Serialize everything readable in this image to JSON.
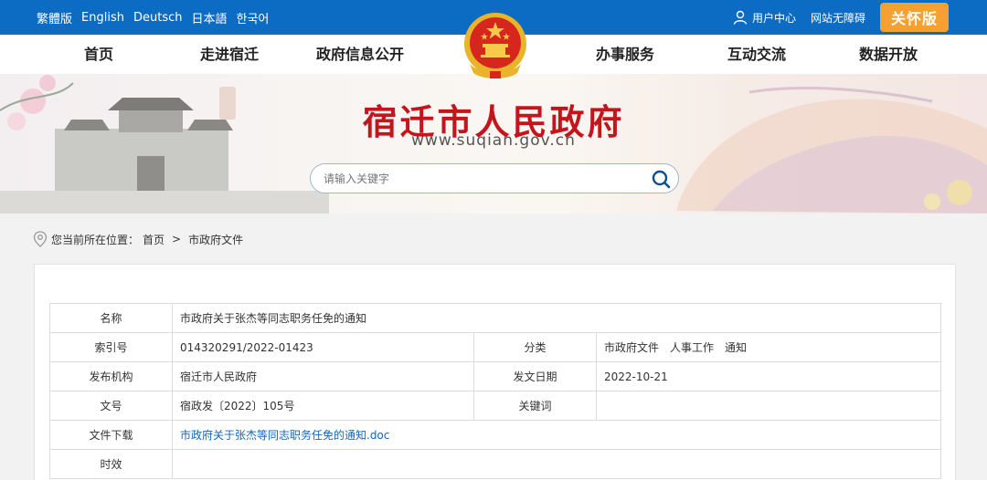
{
  "topbar": {
    "languages": [
      "繁體版",
      "English",
      "Deutsch",
      "日本語",
      "한국어"
    ],
    "user_center": "用户中心",
    "accessibility": "网站无障碍",
    "care_mode": "关怀版"
  },
  "nav": {
    "items": [
      "首页",
      "走进宿迁",
      "政府信息公开",
      "办事服务",
      "互动交流",
      "数据开放"
    ]
  },
  "banner": {
    "title": "宿迁市人民政府",
    "url": "www.suqian.gov.cn",
    "search_placeholder": "请输入关键字"
  },
  "breadcrumb": {
    "prefix": "您当前所在位置：",
    "home": "首页",
    "separator": ">",
    "current": "市政府文件"
  },
  "doc": {
    "name_label": "名称",
    "name_value": "市政府关于张杰等同志职务任免的通知",
    "index_label": "索引号",
    "index_value": "014320291/2022-01423",
    "category_label": "分类",
    "category_value": "市政府文件　人事工作　通知",
    "publisher_label": "发布机构",
    "publisher_value": "宿迁市人民政府",
    "date_label": "发文日期",
    "date_value": "2022-10-21",
    "docno_label": "文号",
    "docno_value": "宿政发〔2022〕105号",
    "keywords_label": "关键词",
    "keywords_value": "",
    "download_label": "文件下载",
    "download_value": "市政府关于张杰等同志职务任免的通知.doc",
    "validity_label": "时效",
    "validity_value": ""
  },
  "colors": {
    "topbar": "#0c6bc2",
    "care_button": "#f4a131",
    "title_red": "#c4151c",
    "link": "#1665b8"
  }
}
